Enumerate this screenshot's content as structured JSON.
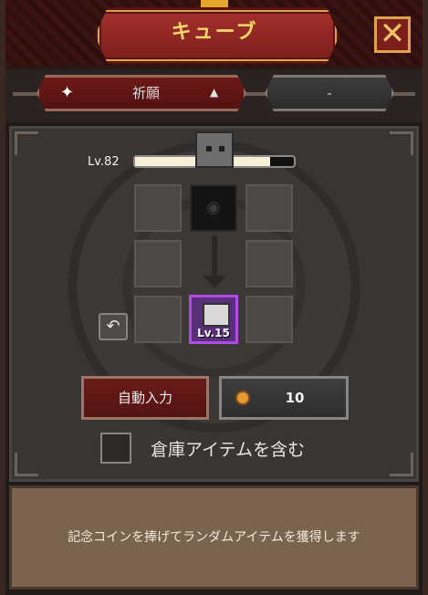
{
  "header": {
    "title": "キューブ"
  },
  "dropdowns": [
    {
      "label": "祈願",
      "icon": "sparkle-icon"
    },
    {
      "label": "-"
    }
  ],
  "cube": {
    "level_label": "Lv.82",
    "progress": 0.85
  },
  "grid": {
    "result_item": {
      "level_label": "Lv.15"
    }
  },
  "buttons": {
    "auto_input": "自動入力",
    "cost": "10"
  },
  "checkbox": {
    "label": "倉庫アイテムを含む",
    "checked": false
  },
  "description": "記念コインを捧げてランダムアイテムを獲得します",
  "colors": {
    "accent_red": "#7c1f1c",
    "gold": "#f4d66a",
    "item_purple": "#b04ce6"
  }
}
